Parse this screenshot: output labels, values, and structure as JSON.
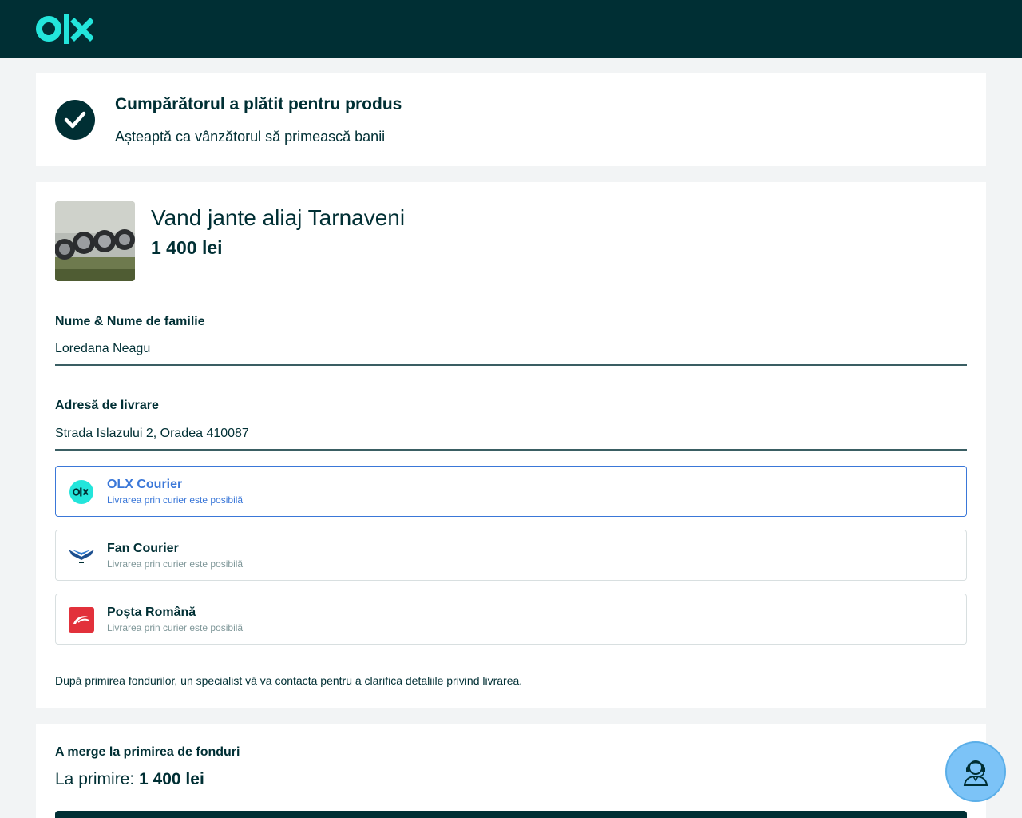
{
  "header": {
    "logo_text": "olx",
    "logo_color": "#23e5db",
    "background": "#002f34"
  },
  "status": {
    "icon": "checkmark-icon",
    "title": "Cumpărătorul a plătit pentru produs",
    "subtitle": "Așteaptă ca vânzătorul să primească banii"
  },
  "product": {
    "image": "alloy-wheels-photo",
    "title": "Vand jante aliaj Tarnaveni",
    "price": "1 400 lei"
  },
  "form": {
    "name_label": "Nume & Nume de familie",
    "name_value": "Loredana Neagu",
    "address_label": "Adresă de livrare",
    "address_value": "Strada Islazului 2, Oradea 410087"
  },
  "couriers": [
    {
      "name": "OLX Courier",
      "description": "Livrarea prin curier este posibilă",
      "selected": true,
      "icon": "olx-courier-icon"
    },
    {
      "name": "Fan Courier",
      "description": "Livrarea prin curier este posibilă",
      "selected": false,
      "icon": "fan-courier-icon"
    },
    {
      "name": "Poșta Română",
      "description": "Livrarea prin curier este posibilă",
      "selected": false,
      "icon": "posta-romana-icon"
    }
  ],
  "note": "După primirea fondurilor, un specialist vă va contacta pentru a clarifica detaliile privind livrarea.",
  "funds": {
    "title": "A merge la primirea de fonduri",
    "label": "La primire:",
    "amount": "1 400 lei"
  },
  "support": {
    "icon": "support-agent-icon"
  },
  "colors": {
    "primary": "#002f34",
    "accent_blue": "#3a77d8",
    "support_bubble": "#7cc3f7"
  }
}
